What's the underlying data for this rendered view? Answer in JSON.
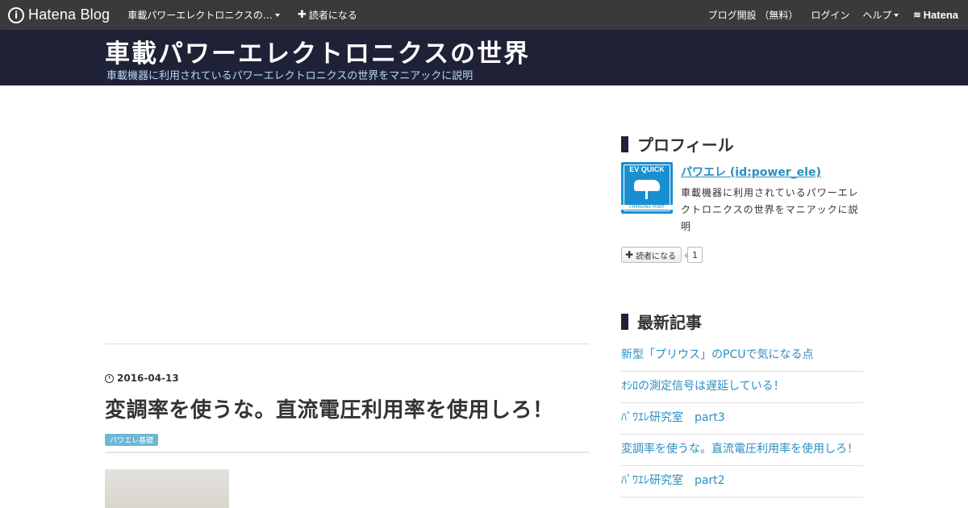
{
  "globalbar": {
    "logo_text": "Hatena Blog",
    "blog_menu": "車載パワーエレクトロニクスの…",
    "subscribe": "読者になる",
    "create_blog": "ブログ開設 （無料）",
    "login": "ログイン",
    "help": "ヘルプ",
    "hatena": "Hatena"
  },
  "header": {
    "title": "車載パワーエレクトロニクスの世界",
    "description": "車載機器に利用されているパワーエレクトロニクスの世界をマニアックに説明"
  },
  "entry": {
    "date": "2016-04-13",
    "title": "変調率を使うな。直流電圧利用率を使用しろ！",
    "category": "パワエレ基礎"
  },
  "sidebar": {
    "profile": {
      "heading": "プロフィール",
      "icon_text": "EV QUICK",
      "icon_subtext": "CHARGING POINT",
      "name": "パワエレ (id:power_ele)",
      "description": "車載機器に利用されているパワーエレクトロニクスの世界をマニアックに説明",
      "subscribe_label": "読者になる",
      "subscriber_count": "1"
    },
    "recent": {
      "heading": "最新記事",
      "items": [
        "新型「プリウス」のPCUで気になる点",
        "ｵｼﾛの測定信号は遅延している！",
        "ﾊﾟﾜｴﾚ研究室　part3",
        "変調率を使うな。直流電圧利用率を使用しろ！",
        "ﾊﾟﾜｴﾚ研究室　part2"
      ]
    }
  },
  "colors": {
    "globalbar": "#3a3a3a",
    "header": "#1f2136",
    "link": "#2a8ec2",
    "category": "#6db7d6"
  }
}
